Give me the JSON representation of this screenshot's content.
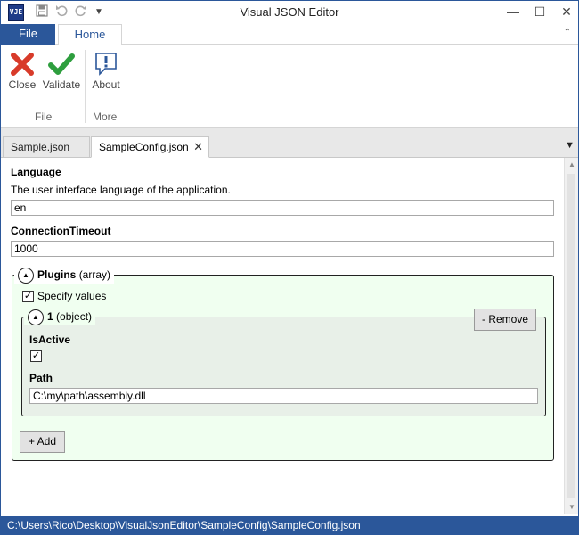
{
  "app": {
    "title": "Visual JSON Editor",
    "icon_text": "VJE"
  },
  "quick_access": {
    "save_icon": "save-icon",
    "undo_icon": "undo-icon",
    "redo_icon": "redo-icon",
    "customize_icon": "dropdown-icon"
  },
  "ribbon": {
    "file_tab": "File",
    "home_tab": "Home",
    "groups": [
      {
        "label": "File",
        "buttons": [
          {
            "label": "Close",
            "icon": "close-icon"
          },
          {
            "label": "Validate",
            "icon": "checkmark-icon"
          }
        ]
      },
      {
        "label": "More",
        "buttons": [
          {
            "label": "About",
            "icon": "about-icon"
          }
        ]
      }
    ]
  },
  "tabs": [
    {
      "label": "Sample.json"
    },
    {
      "label": "SampleConfig.json",
      "active": true
    }
  ],
  "form": {
    "language": {
      "title": "Language",
      "description": "The user interface language of the application.",
      "value": "en"
    },
    "connection_timeout": {
      "title": "ConnectionTimeout",
      "value": "1000"
    },
    "plugins": {
      "title": "Plugins",
      "type_hint": "(array)",
      "specify_values_label": "Specify values",
      "specify_values_checked": true,
      "item": {
        "index": "1",
        "type_hint": "(object)",
        "remove_label": "- Remove",
        "is_active_title": "IsActive",
        "is_active_checked": true,
        "path_title": "Path",
        "path_value": "C:\\my\\path\\assembly.dll"
      },
      "add_label": "+ Add"
    }
  },
  "status": {
    "path": "C:\\Users\\Rico\\Desktop\\VisualJsonEditor\\SampleConfig\\SampleConfig.json"
  },
  "colors": {
    "accent": "#2b579a",
    "close_red": "#d83b2a",
    "validate_green": "#2e9e3e",
    "array_bg": "#f0fff0",
    "object_bg": "#e8f0e8"
  }
}
